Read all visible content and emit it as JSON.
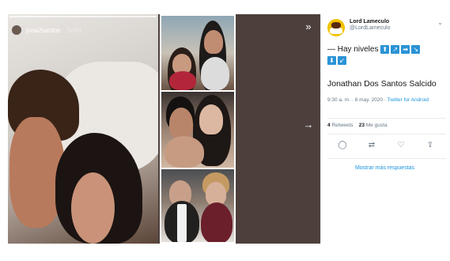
{
  "story": {
    "username": "jona2santos",
    "time": "5min"
  },
  "viewer": {
    "close_icon": "»",
    "next_icon": "→"
  },
  "tweet": {
    "name": "Lord Lameculo",
    "handle": "@LordLameculo",
    "text": "— Hay niveles",
    "emojis": [
      "⬆",
      "↗",
      "➡",
      "↘",
      "⬇",
      "↙"
    ],
    "title": "Jonathan Dos Santos Salcido",
    "timestamp": "9:30 a. m. · 8 may. 2020 · ",
    "source": "Twitter for Android",
    "retweets_count": "4",
    "retweets_label": "Retweets",
    "likes_count": "23",
    "likes_label": "Me gusta",
    "more_replies": "Mostrar más respuestas"
  }
}
